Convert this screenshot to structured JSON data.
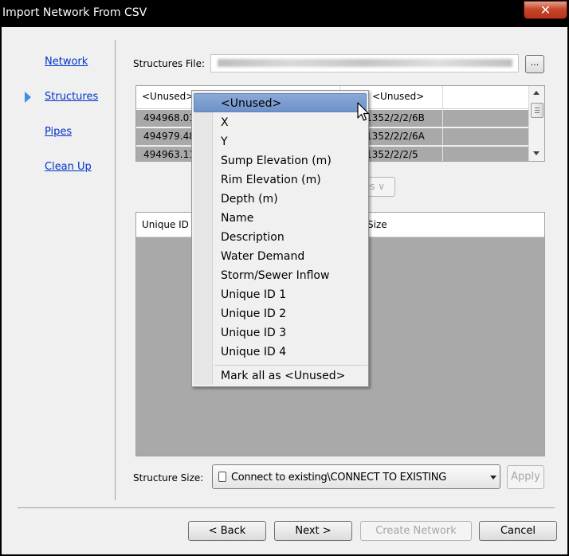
{
  "window": {
    "title": "Import Network From CSV",
    "close_glyph": "✕"
  },
  "nav": {
    "items": [
      "Network",
      "Structures",
      "Pipes",
      "Clean Up"
    ],
    "active": "Structures"
  },
  "structures_file": {
    "label": "Structures File:",
    "browse_label": "..."
  },
  "grid1": {
    "headers": [
      "<Unused>",
      "<Unused>"
    ],
    "rows": [
      [
        "494968.01",
        "1352/2/2/6B"
      ],
      [
        "494979.48",
        "1352/2/2/6A"
      ],
      [
        "494963.11",
        "1352/2/2/5"
      ]
    ]
  },
  "ids_button_label": "Ds ∨",
  "grid2": {
    "headers": [
      "Unique ID",
      "Size"
    ]
  },
  "structure_size": {
    "label": "Structure Size:",
    "value": "Connect to existing\\CONNECT TO EXISTING",
    "apply_label": "Apply"
  },
  "footer": {
    "back_label": "< Back",
    "next_label": "Next >",
    "create_label": "Create Network",
    "cancel_label": "Cancel"
  },
  "context_menu": {
    "items": [
      "<Unused>",
      "X",
      "Y",
      "Sump Elevation (m)",
      "Rim Elevation (m)",
      "Depth (m)",
      "Name",
      "Description",
      "Water Demand",
      "Storm/Sewer Inflow",
      "Unique ID 1",
      "Unique ID 2",
      "Unique ID 3",
      "Unique ID 4"
    ],
    "highlighted": "<Unused>",
    "footer_item": "Mark all as <Unused>"
  },
  "colors": {
    "accent": "#3c8ee8",
    "link": "#0033cc",
    "menu_highlight": "#7b9ccf",
    "grid_row": "#a9a9a9"
  }
}
